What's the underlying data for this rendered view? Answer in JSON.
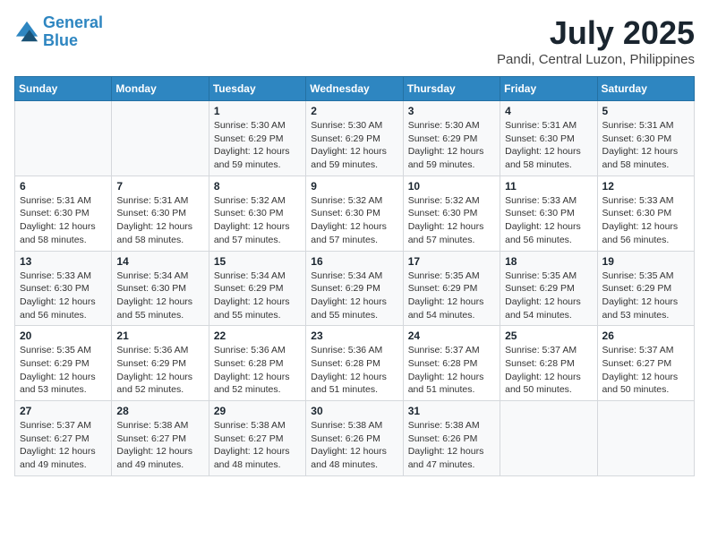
{
  "header": {
    "logo_line1": "General",
    "logo_line2": "Blue",
    "month": "July 2025",
    "location": "Pandi, Central Luzon, Philippines"
  },
  "weekdays": [
    "Sunday",
    "Monday",
    "Tuesday",
    "Wednesday",
    "Thursday",
    "Friday",
    "Saturday"
  ],
  "weeks": [
    [
      {
        "day": null,
        "sunrise": null,
        "sunset": null,
        "daylight": null
      },
      {
        "day": null,
        "sunrise": null,
        "sunset": null,
        "daylight": null
      },
      {
        "day": "1",
        "sunrise": "Sunrise: 5:30 AM",
        "sunset": "Sunset: 6:29 PM",
        "daylight": "Daylight: 12 hours and 59 minutes."
      },
      {
        "day": "2",
        "sunrise": "Sunrise: 5:30 AM",
        "sunset": "Sunset: 6:29 PM",
        "daylight": "Daylight: 12 hours and 59 minutes."
      },
      {
        "day": "3",
        "sunrise": "Sunrise: 5:30 AM",
        "sunset": "Sunset: 6:29 PM",
        "daylight": "Daylight: 12 hours and 59 minutes."
      },
      {
        "day": "4",
        "sunrise": "Sunrise: 5:31 AM",
        "sunset": "Sunset: 6:30 PM",
        "daylight": "Daylight: 12 hours and 58 minutes."
      },
      {
        "day": "5",
        "sunrise": "Sunrise: 5:31 AM",
        "sunset": "Sunset: 6:30 PM",
        "daylight": "Daylight: 12 hours and 58 minutes."
      }
    ],
    [
      {
        "day": "6",
        "sunrise": "Sunrise: 5:31 AM",
        "sunset": "Sunset: 6:30 PM",
        "daylight": "Daylight: 12 hours and 58 minutes."
      },
      {
        "day": "7",
        "sunrise": "Sunrise: 5:31 AM",
        "sunset": "Sunset: 6:30 PM",
        "daylight": "Daylight: 12 hours and 58 minutes."
      },
      {
        "day": "8",
        "sunrise": "Sunrise: 5:32 AM",
        "sunset": "Sunset: 6:30 PM",
        "daylight": "Daylight: 12 hours and 57 minutes."
      },
      {
        "day": "9",
        "sunrise": "Sunrise: 5:32 AM",
        "sunset": "Sunset: 6:30 PM",
        "daylight": "Daylight: 12 hours and 57 minutes."
      },
      {
        "day": "10",
        "sunrise": "Sunrise: 5:32 AM",
        "sunset": "Sunset: 6:30 PM",
        "daylight": "Daylight: 12 hours and 57 minutes."
      },
      {
        "day": "11",
        "sunrise": "Sunrise: 5:33 AM",
        "sunset": "Sunset: 6:30 PM",
        "daylight": "Daylight: 12 hours and 56 minutes."
      },
      {
        "day": "12",
        "sunrise": "Sunrise: 5:33 AM",
        "sunset": "Sunset: 6:30 PM",
        "daylight": "Daylight: 12 hours and 56 minutes."
      }
    ],
    [
      {
        "day": "13",
        "sunrise": "Sunrise: 5:33 AM",
        "sunset": "Sunset: 6:30 PM",
        "daylight": "Daylight: 12 hours and 56 minutes."
      },
      {
        "day": "14",
        "sunrise": "Sunrise: 5:34 AM",
        "sunset": "Sunset: 6:30 PM",
        "daylight": "Daylight: 12 hours and 55 minutes."
      },
      {
        "day": "15",
        "sunrise": "Sunrise: 5:34 AM",
        "sunset": "Sunset: 6:29 PM",
        "daylight": "Daylight: 12 hours and 55 minutes."
      },
      {
        "day": "16",
        "sunrise": "Sunrise: 5:34 AM",
        "sunset": "Sunset: 6:29 PM",
        "daylight": "Daylight: 12 hours and 55 minutes."
      },
      {
        "day": "17",
        "sunrise": "Sunrise: 5:35 AM",
        "sunset": "Sunset: 6:29 PM",
        "daylight": "Daylight: 12 hours and 54 minutes."
      },
      {
        "day": "18",
        "sunrise": "Sunrise: 5:35 AM",
        "sunset": "Sunset: 6:29 PM",
        "daylight": "Daylight: 12 hours and 54 minutes."
      },
      {
        "day": "19",
        "sunrise": "Sunrise: 5:35 AM",
        "sunset": "Sunset: 6:29 PM",
        "daylight": "Daylight: 12 hours and 53 minutes."
      }
    ],
    [
      {
        "day": "20",
        "sunrise": "Sunrise: 5:35 AM",
        "sunset": "Sunset: 6:29 PM",
        "daylight": "Daylight: 12 hours and 53 minutes."
      },
      {
        "day": "21",
        "sunrise": "Sunrise: 5:36 AM",
        "sunset": "Sunset: 6:29 PM",
        "daylight": "Daylight: 12 hours and 52 minutes."
      },
      {
        "day": "22",
        "sunrise": "Sunrise: 5:36 AM",
        "sunset": "Sunset: 6:28 PM",
        "daylight": "Daylight: 12 hours and 52 minutes."
      },
      {
        "day": "23",
        "sunrise": "Sunrise: 5:36 AM",
        "sunset": "Sunset: 6:28 PM",
        "daylight": "Daylight: 12 hours and 51 minutes."
      },
      {
        "day": "24",
        "sunrise": "Sunrise: 5:37 AM",
        "sunset": "Sunset: 6:28 PM",
        "daylight": "Daylight: 12 hours and 51 minutes."
      },
      {
        "day": "25",
        "sunrise": "Sunrise: 5:37 AM",
        "sunset": "Sunset: 6:28 PM",
        "daylight": "Daylight: 12 hours and 50 minutes."
      },
      {
        "day": "26",
        "sunrise": "Sunrise: 5:37 AM",
        "sunset": "Sunset: 6:27 PM",
        "daylight": "Daylight: 12 hours and 50 minutes."
      }
    ],
    [
      {
        "day": "27",
        "sunrise": "Sunrise: 5:37 AM",
        "sunset": "Sunset: 6:27 PM",
        "daylight": "Daylight: 12 hours and 49 minutes."
      },
      {
        "day": "28",
        "sunrise": "Sunrise: 5:38 AM",
        "sunset": "Sunset: 6:27 PM",
        "daylight": "Daylight: 12 hours and 49 minutes."
      },
      {
        "day": "29",
        "sunrise": "Sunrise: 5:38 AM",
        "sunset": "Sunset: 6:27 PM",
        "daylight": "Daylight: 12 hours and 48 minutes."
      },
      {
        "day": "30",
        "sunrise": "Sunrise: 5:38 AM",
        "sunset": "Sunset: 6:26 PM",
        "daylight": "Daylight: 12 hours and 48 minutes."
      },
      {
        "day": "31",
        "sunrise": "Sunrise: 5:38 AM",
        "sunset": "Sunset: 6:26 PM",
        "daylight": "Daylight: 12 hours and 47 minutes."
      },
      {
        "day": null,
        "sunrise": null,
        "sunset": null,
        "daylight": null
      },
      {
        "day": null,
        "sunrise": null,
        "sunset": null,
        "daylight": null
      }
    ]
  ]
}
